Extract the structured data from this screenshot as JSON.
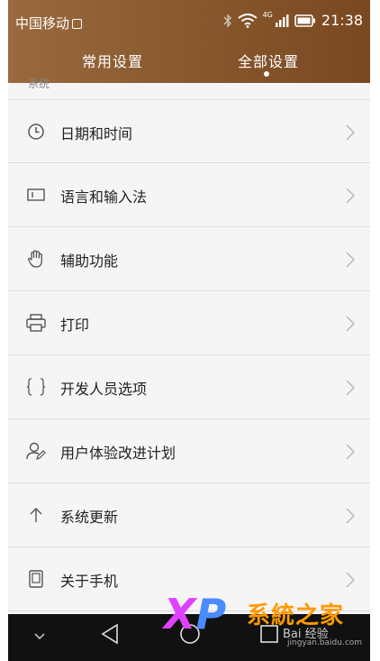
{
  "status_bar": {
    "carrier": "中国移动",
    "network": "4G",
    "time": "21:38"
  },
  "tabs": [
    {
      "label": "常用设置",
      "selected": false
    },
    {
      "label": "全部设置",
      "selected": true
    }
  ],
  "section": {
    "label": "系统"
  },
  "items": [
    {
      "label": "日期和时间",
      "icon": "clock-icon"
    },
    {
      "label": "语言和输入法",
      "icon": "keyboard-icon"
    },
    {
      "label": "辅助功能",
      "icon": "hand-icon"
    },
    {
      "label": "打印",
      "icon": "printer-icon"
    },
    {
      "label": "开发人员选项",
      "icon": "braces-icon"
    },
    {
      "label": "用户体验改进计划",
      "icon": "user-edit-icon"
    },
    {
      "label": "系统更新",
      "icon": "arrow-up-icon"
    },
    {
      "label": "关于手机",
      "icon": "phone-icon"
    }
  ],
  "watermark": {
    "brand_x": "X",
    "brand_p": "P",
    "title": "系統之家",
    "baidu": "Bai 经验",
    "url": "jingyan.baidu.com"
  },
  "colors": {
    "header_start": "#9a6a3e",
    "header_end": "#7a4820",
    "list_bg": "#f5f5f5",
    "navbar": "#111111"
  }
}
